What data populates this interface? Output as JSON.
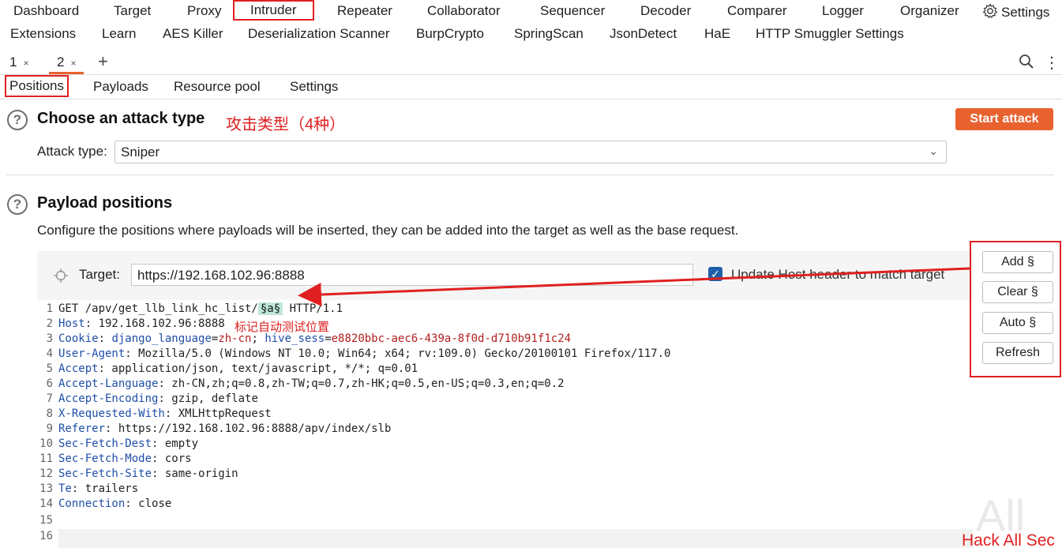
{
  "menu": {
    "row1": [
      "Dashboard",
      "Target",
      "Proxy",
      "Intruder",
      "Repeater",
      "Collaborator",
      "Sequencer",
      "Decoder",
      "Comparer",
      "Logger",
      "Organizer",
      "Settings"
    ],
    "row2": [
      "Extensions",
      "Learn",
      "AES Killer",
      "Deserialization Scanner",
      "BurpCrypto",
      "SpringScan",
      "JsonDetect",
      "HaE",
      "HTTP Smuggler Settings"
    ],
    "active": "Intruder"
  },
  "tabs": [
    {
      "label": "1",
      "close": "×"
    },
    {
      "label": "2",
      "close": "×"
    }
  ],
  "tab_add": "+",
  "subtabs": [
    "Positions",
    "Payloads",
    "Resource pool",
    "Settings"
  ],
  "attack": {
    "heading": "Choose an attack type",
    "annotation": "攻击类型（4种）",
    "start_label": "Start attack",
    "type_label": "Attack type:",
    "type_value": "Sniper"
  },
  "positions": {
    "heading": "Payload positions",
    "description": "Configure the positions where payloads will be inserted, they can be added into the target as well as the base request.",
    "target_label": "Target:",
    "target_value": "https://192.168.102.96:8888",
    "update_host_label": "Update Host header to match target",
    "update_host_checked": true,
    "annotation": "标记自动测试位置"
  },
  "side_buttons": [
    "Add §",
    "Clear §",
    "Auto §",
    "Refresh"
  ],
  "request_lines": [
    {
      "n": "1",
      "pre": "GET /apv/get_llb_link_hc_list/",
      "marker": "§a§",
      "post": " HTTP/1.1"
    },
    {
      "n": "2",
      "key": "Host",
      "val": ": 192.168.102.96:8888"
    },
    {
      "n": "3",
      "key": "Cookie",
      "ck1": "django_language",
      "cv1": "zh-cn",
      "ck2": "hive_sess",
      "cv2": "e8820bbc-aec6-439a-8f0d-d710b91f1c24"
    },
    {
      "n": "4",
      "key": "User-Agent",
      "val": ": Mozilla/5.0 (Windows NT 10.0; Win64; x64; rv:109.0) Gecko/20100101 Firefox/117.0"
    },
    {
      "n": "5",
      "key": "Accept",
      "val": ": application/json, text/javascript, */*; q=0.01"
    },
    {
      "n": "6",
      "key": "Accept-Language",
      "val": ": zh-CN,zh;q=0.8,zh-TW;q=0.7,zh-HK;q=0.5,en-US;q=0.3,en;q=0.2"
    },
    {
      "n": "7",
      "key": "Accept-Encoding",
      "val": ": gzip, deflate"
    },
    {
      "n": "8",
      "key": "X-Requested-With",
      "val": ": XMLHttpRequest"
    },
    {
      "n": "9",
      "key": "Referer",
      "val": ": https://192.168.102.96:8888/apv/index/slb"
    },
    {
      "n": "10",
      "key": "Sec-Fetch-Dest",
      "val": ": empty"
    },
    {
      "n": "11",
      "key": "Sec-Fetch-Mode",
      "val": ": cors"
    },
    {
      "n": "12",
      "key": "Sec-Fetch-Site",
      "val": ": same-origin"
    },
    {
      "n": "13",
      "key": "Te",
      "val": ": trailers"
    },
    {
      "n": "14",
      "key": "Connection",
      "val": ": close"
    },
    {
      "n": "15"
    },
    {
      "n": "16"
    }
  ],
  "watermark": {
    "bg": "All",
    "text": "Hack All Sec"
  },
  "colors": {
    "accent": "#e8622f",
    "annotation": "#e02020",
    "header_key": "#1f4ea8",
    "cookie_value": "#b32020",
    "marker_bg": "#bfe8d8"
  }
}
